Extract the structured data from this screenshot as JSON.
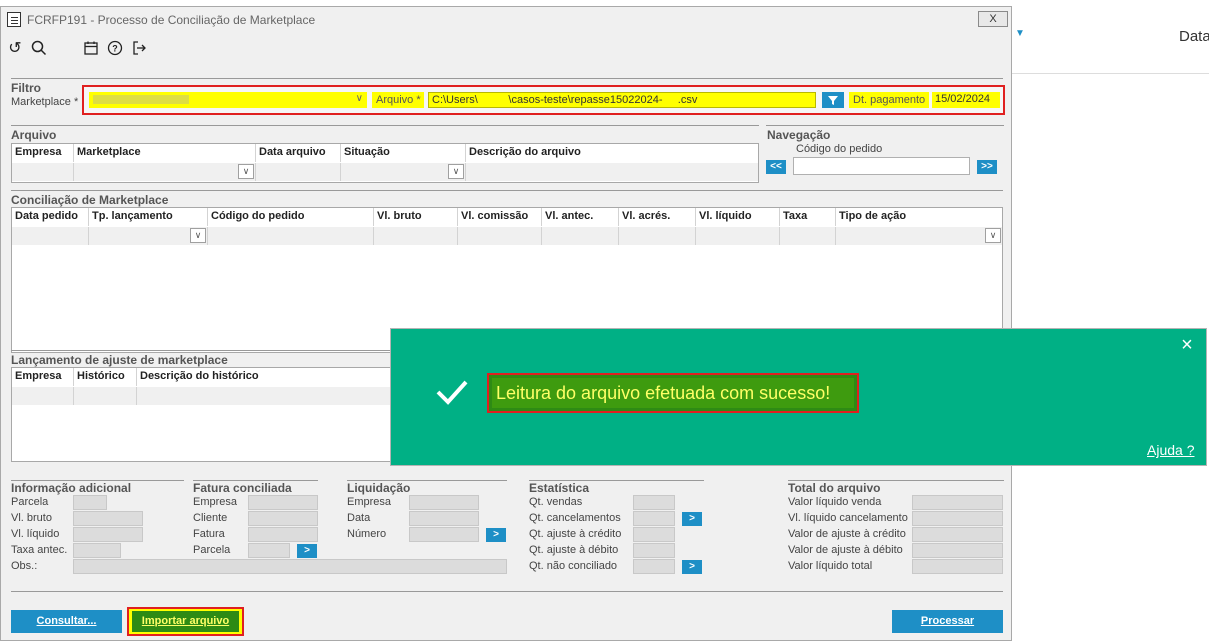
{
  "background": {
    "header_partial": "Data"
  },
  "window": {
    "title": "FCRFP191 - Processo de Conciliação de Marketplace",
    "close_label": "X"
  },
  "filter": {
    "section": "Filtro",
    "marketplace_label": "Marketplace *",
    "arquivo_label": "Arquivo *",
    "arquivo_value": "C:\\Users\\          \\casos-teste\\repasse15022024-     .csv",
    "dt_pagamento_label": "Dt. pagamento",
    "dt_pagamento_value": "15/02/2024"
  },
  "arquivo": {
    "section": "Arquivo",
    "columns": [
      "Empresa",
      "Marketplace",
      "Data arquivo",
      "Situação",
      "Descrição do arquivo"
    ]
  },
  "navegacao": {
    "section": "Navegação",
    "codigo_label": "Código do pedido",
    "prev_label": "<<",
    "next_label": ">>"
  },
  "conciliacao": {
    "section": "Conciliação de Marketplace",
    "columns": [
      "Data pedido",
      "Tp. lançamento",
      "Código do pedido",
      "Vl. bruto",
      "Vl. comissão",
      "Vl. antec.",
      "Vl. acrés.",
      "Vl. líquido",
      "Taxa",
      "Tipo de ação"
    ]
  },
  "ajuste": {
    "section": "Lançamento de ajuste de marketplace",
    "columns": [
      "Empresa",
      "Histórico",
      "Descrição do histórico"
    ]
  },
  "info": {
    "section": "Informação adicional",
    "labels": [
      "Parcela",
      "Vl. bruto",
      "Vl. líquido",
      "Taxa antec.",
      "Obs.:"
    ]
  },
  "fatura": {
    "section": "Fatura conciliada",
    "labels": [
      "Empresa",
      "Cliente",
      "Fatura",
      "Parcela"
    ]
  },
  "liquidacao": {
    "section": "Liquidação",
    "labels": [
      "Empresa",
      "Data",
      "Número"
    ]
  },
  "estatistica": {
    "section": "Estatística",
    "labels": [
      "Qt. vendas",
      "Qt. cancelamentos",
      "Qt. ajuste à crédito",
      "Qt. ajuste à débito",
      "Qt. não conciliado"
    ]
  },
  "total": {
    "section": "Total do arquivo",
    "labels": [
      "Valor líquido venda",
      "Vl. líquido cancelamento",
      "Valor de ajuste à crédito",
      "Valor de ajuste à débito",
      "Valor líquido total"
    ]
  },
  "buttons": {
    "consultar": "Consultar...",
    "importar": "Importar arquivo",
    "processar": "Processar",
    "arrow": ">"
  },
  "toast": {
    "message": "Leitura do arquivo efetuada com sucesso!",
    "help": "Ajuda ?",
    "close": "×"
  },
  "colors": {
    "accent": "#1e8fc6",
    "toast": "#00b085",
    "highlight": "#ffff00",
    "outline": "#e02020"
  }
}
